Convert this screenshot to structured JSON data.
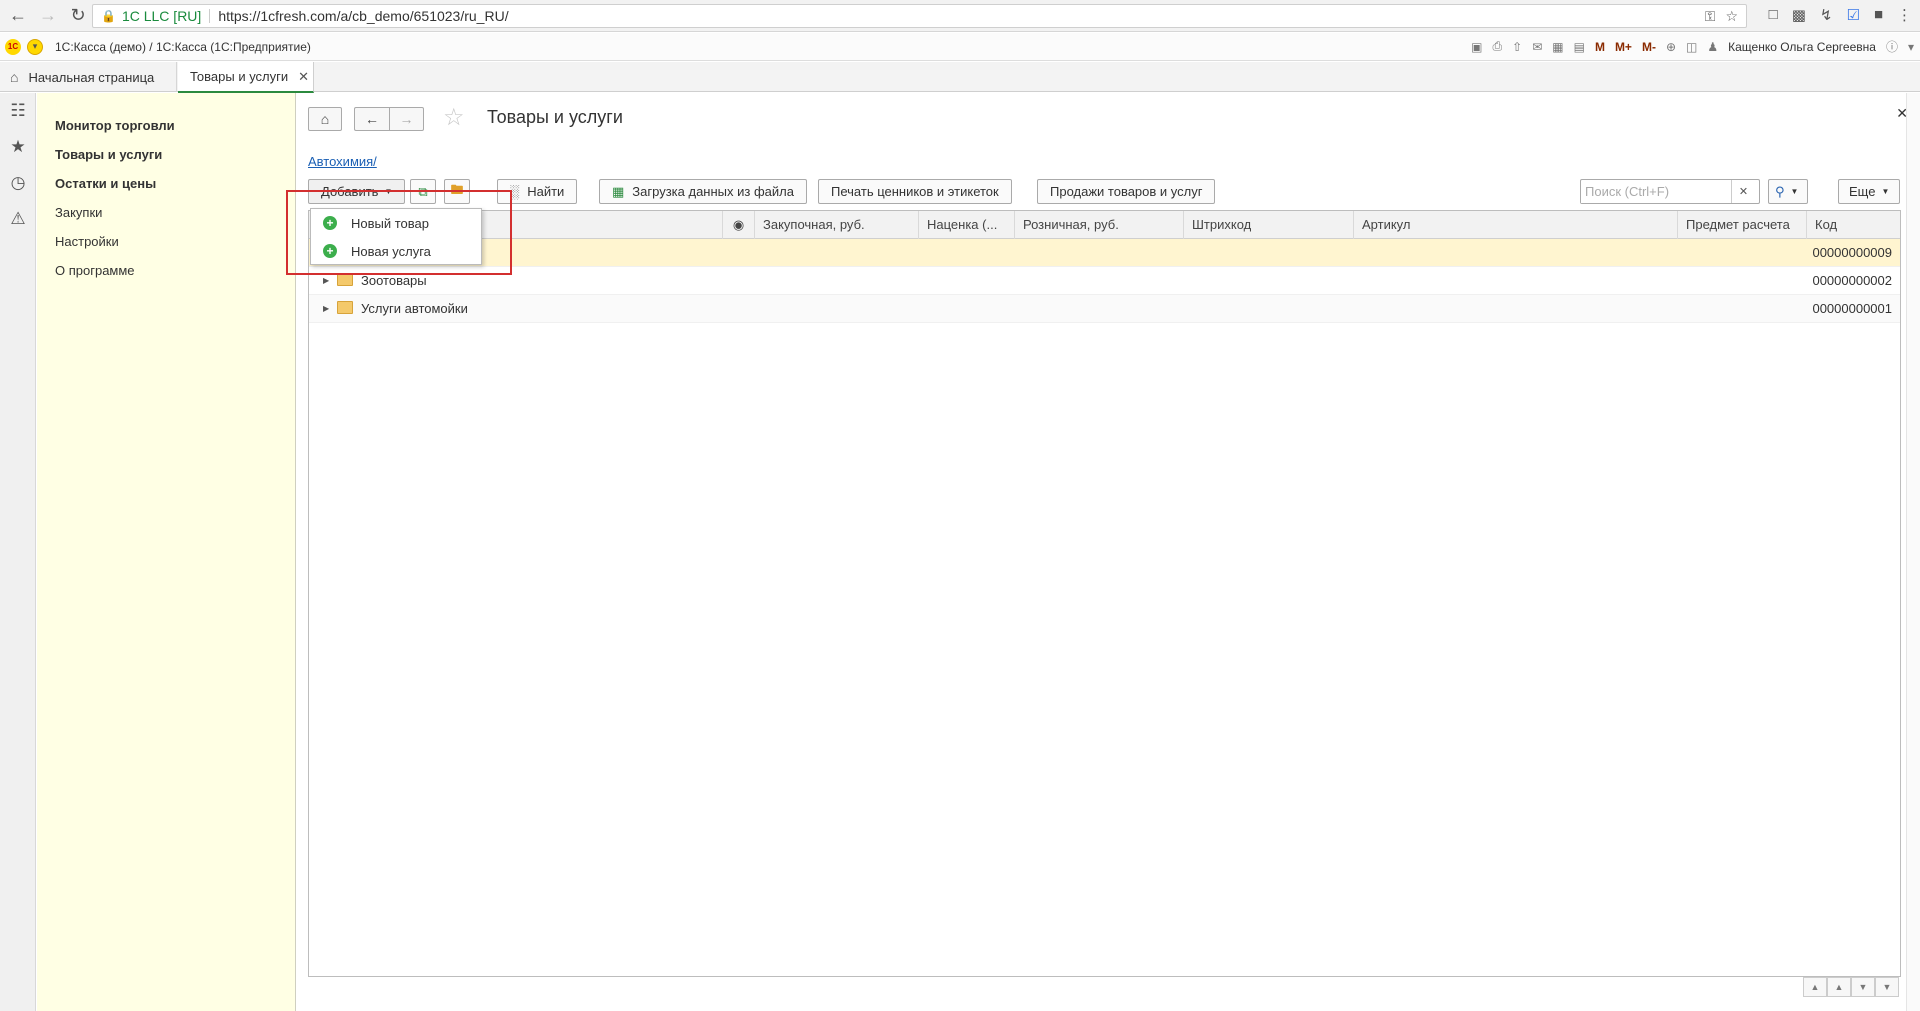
{
  "browser": {
    "secure_label": "1C LLC [RU]",
    "url": "https://1cfresh.com/a/cb_demo/651023/ru_RU/"
  },
  "app_bar": {
    "logo_text": "1С",
    "title": "1С:Касса (демо) / 1С:Касса   (1С:Предприятие)",
    "m": "M",
    "m_plus": "M+",
    "m_minus": "M-",
    "user": "Кащенко Ольга Сергеевна"
  },
  "tabs": [
    {
      "label": "Начальная страница"
    },
    {
      "label": "Товары и услуги"
    }
  ],
  "sections": [
    {
      "label": "Монитор торговли"
    },
    {
      "label": "Товары и услуги"
    },
    {
      "label": "Остатки и цены"
    },
    {
      "label": "Закупки"
    },
    {
      "label": "Настройки"
    },
    {
      "label": "О программе"
    }
  ],
  "form": {
    "title": "Товары и услуги",
    "breadcrumb": "Автохимия/",
    "add_label": "Добавить",
    "find_label": "Найти",
    "load_label": "Загрузка данных из файла",
    "print_label": "Печать ценников и этикеток",
    "sales_label": "Продажи товаров и услуг",
    "search_placeholder": "Поиск (Ctrl+F)",
    "more_label": "Еще"
  },
  "table": {
    "columns": [
      {
        "label": "Закупочная, руб."
      },
      {
        "label": "Наценка (..."
      },
      {
        "label": "Розничная, руб."
      },
      {
        "label": "Штрихкод"
      },
      {
        "label": "Артикул"
      },
      {
        "label": "Предмет расчета"
      },
      {
        "label": "Код"
      }
    ],
    "rows": [
      {
        "name": "",
        "code": "00000000009"
      },
      {
        "name": "Зоотовары",
        "code": "00000000002"
      },
      {
        "name": "Услуги автомойки",
        "code": "00000000001"
      }
    ]
  },
  "dropdown": {
    "items": [
      {
        "label": "Новый товар"
      },
      {
        "label": "Новая услуга"
      }
    ]
  },
  "colors": {
    "section_panel_bg": "#ffffe4",
    "selected_row_bg": "#fff5d0",
    "highlight_border": "#d32f2f",
    "accent_green": "#2b8a3e"
  }
}
